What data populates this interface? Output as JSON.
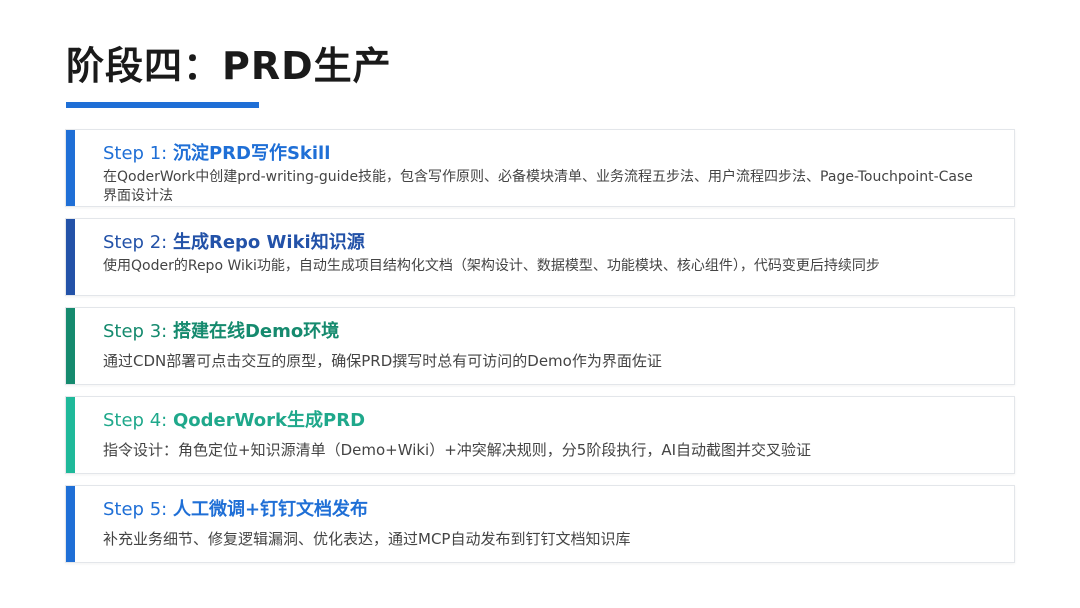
{
  "title": "阶段四：PRD生产",
  "colors": {
    "title_underline": "#1f6fd6",
    "card_border": "#e3e6ea"
  },
  "steps": [
    {
      "label": "Step 1: ",
      "title": "沉淀PRD写作Skill",
      "desc": "在QoderWork中创建prd-writing-guide技能，包含写作原则、必备模块清单、业务流程五步法、用户流程四步法、Page-Touchpoint-Case界面设计法",
      "accent": "#1f6fd6",
      "text_color": "#1f6fd6"
    },
    {
      "label": "Step 2: ",
      "title": "生成Repo Wiki知识源",
      "desc": "使用Qoder的Repo Wiki功能，自动生成项目结构化文档（架构设计、数据模型、功能模块、核心组件），代码变更后持续同步",
      "accent": "#2352a8",
      "text_color": "#2352a8"
    },
    {
      "label": "Step 3: ",
      "title": "搭建在线Demo环境",
      "desc": "通过CDN部署可点击交互的原型，确保PRD撰写时总有可访问的Demo作为界面佐证",
      "accent": "#158a6e",
      "text_color": "#158a6e"
    },
    {
      "label": "Step 4: ",
      "title": "QoderWork生成PRD",
      "desc": "指令设计：角色定位+知识源清单（Demo+Wiki）+冲突解决规则，分5阶段执行，AI自动截图并交叉验证",
      "accent": "#1fb99a",
      "text_color": "#1fa88b"
    },
    {
      "label": "Step 5: ",
      "title": "人工微调+钉钉文档发布",
      "desc": "补充业务细节、修复逻辑漏洞、优化表达，通过MCP自动发布到钉钉文档知识库",
      "accent": "#1f6fd6",
      "text_color": "#1f6fd6"
    }
  ]
}
